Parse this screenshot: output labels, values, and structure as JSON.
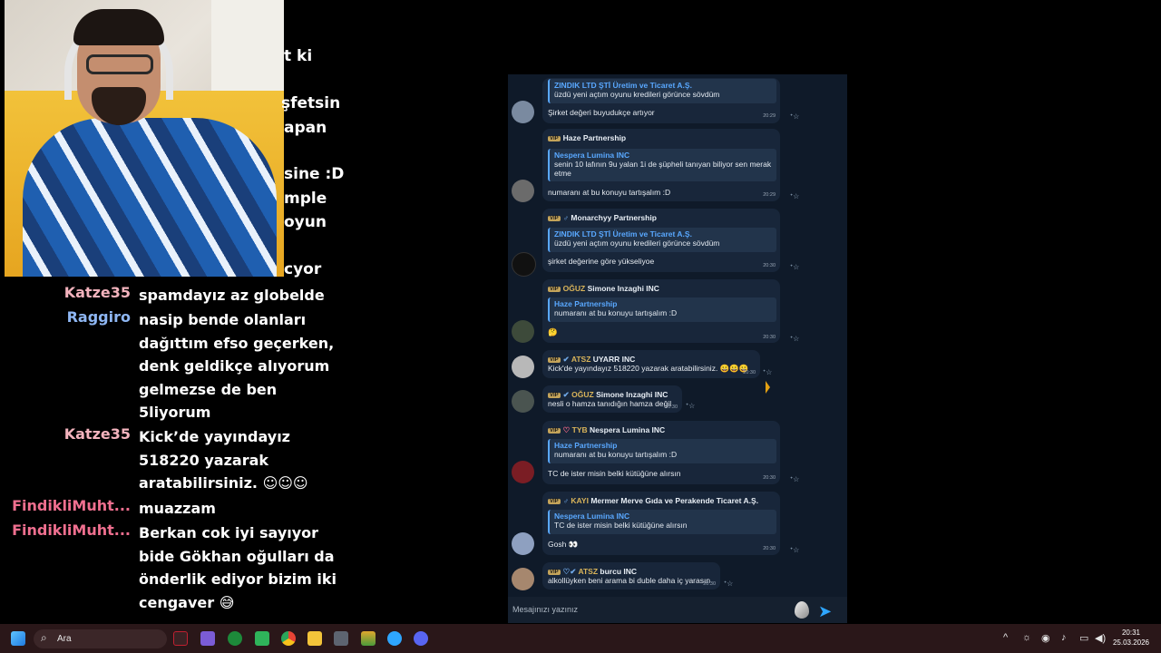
{
  "overlay_fragments": [
    "t ki",
    "şfetsin",
    "apan",
    "sine :D",
    "mple",
    "oyun",
    "cyor"
  ],
  "chat": [
    {
      "user": "Katze35",
      "color": "#f3b3bd",
      "message": "spamdayız az globelde"
    },
    {
      "user": "Raggiro",
      "color": "#8eb6f2",
      "message": "nasip bende olanları dağıttım efso geçerken, denk geldikçe alıyorum gelmezse de ben 5liyorum"
    },
    {
      "user": "Katze35",
      "color": "#f3b3bd",
      "message": "Kick’de yayındayız 518220 yazarak aratabilirsiniz. ☺☺☺"
    },
    {
      "user": "FindikliMuht...",
      "color": "#ef6f8f",
      "message": "muazzam"
    },
    {
      "user": "FindikliMuht...",
      "color": "#ef6f8f",
      "message": "Berkan cok iyi sayıyor bide Gökhan oğulları da önderlik ediyor bizim iki cengaver 😅"
    }
  ],
  "telegram": {
    "messages": [
      {
        "sender": "",
        "tag": "",
        "clan": "",
        "sym": "",
        "reply_name": "ZINDIK LTD ŞTİ Üretim ve Ticaret A.Ş.",
        "reply_text": "üzdü yeni açtım oyunu kredileri görünce sövdüm",
        "text": "Şirket değeri buyudukçe artıyor",
        "time": "20:29"
      },
      {
        "sender": "Haze Partnership",
        "tag": "VIP",
        "clan": "",
        "sym": "",
        "reply_name": "Nespera Lumina INC",
        "reply_text": "senin 10 lafının 9u yalan 1i de şüpheli tanıyan biliyor sen merak etme",
        "text": "numaranı at bu konuyu tartışalım :D",
        "time": "20:29"
      },
      {
        "sender": "Monarchyy Partnership",
        "tag": "VIP",
        "clan": "",
        "sym": "♂",
        "reply_name": "ZINDIK LTD ŞTİ Üretim ve Ticaret A.Ş.",
        "reply_text": "üzdü yeni açtım oyunu kredileri görünce sövdüm",
        "text": "şirket değerine göre yükseliyoe",
        "time": "20:30"
      },
      {
        "sender": "Simone Inzaghi INC",
        "tag": "VIP",
        "clan": "OĞUZ",
        "sym": "",
        "reply_name": "Haze Partnership",
        "reply_text": "numaranı at bu konuyu tartışalım :D",
        "text": "🤔",
        "time": "20:30"
      },
      {
        "sender": "UYARR INC",
        "tag": "VIP",
        "clan": "ATSZ",
        "sym": "✔",
        "reply_name": "",
        "reply_text": "",
        "text": "Kick'de yayındayız 518220 yazarak aratabilirsiniz. 😀😀😀",
        "time": "20:30"
      },
      {
        "sender": "Simone Inzaghi INC",
        "tag": "VIP",
        "clan": "OĞUZ",
        "sym": "✔",
        "reply_name": "",
        "reply_text": "",
        "text": "nesli o hamza tanıdığın hamza değil",
        "time": "20:30"
      },
      {
        "sender": "Nespera Lumina INC",
        "tag": "VIP",
        "clan": "TYB",
        "sym": "♡",
        "reply_name": "Haze Partnership",
        "reply_text": "numaranı at bu konuyu tartışalım :D",
        "text": "TC de ister misin belki kütüğüne alırsın",
        "time": "20:30"
      },
      {
        "sender": "Mermer Merve Gıda ve Perakende Ticaret A.Ş.",
        "tag": "VIP",
        "clan": "KAYI",
        "sym": "♂",
        "reply_name": "Nespera Lumina INC",
        "reply_text": "TC de ister misin belki kütüğüne alırsın",
        "text": "Gosh 👀",
        "time": "20:30"
      },
      {
        "sender": "burcu INC",
        "tag": "VIP",
        "clan": "ATSZ",
        "sym": "♡✔",
        "reply_name": "",
        "reply_text": "",
        "text": "alkollüyken beni arama bi duble daha iç yarasın",
        "time": "20:30"
      }
    ],
    "input_placeholder": "Mesajınızı yazınız"
  },
  "taskbar": {
    "search_placeholder": "Ara",
    "clock_time": "20:31",
    "clock_date": "25.03.2026",
    "apps": [
      "start-icon",
      "razer-icon",
      "notes-icon",
      "xbox-icon",
      "game-icon",
      "chrome-icon",
      "folder-icon",
      "calculator-icon",
      "stack-icon",
      "telegram-icon",
      "discord-icon"
    ]
  }
}
